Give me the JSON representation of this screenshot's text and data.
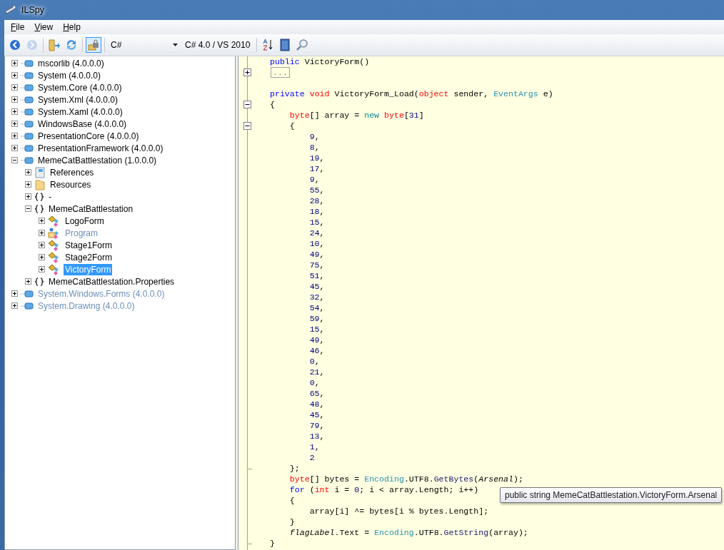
{
  "window": {
    "title": "ILSpy"
  },
  "menu": [
    {
      "label": "File"
    },
    {
      "label": "View"
    },
    {
      "label": "Help"
    }
  ],
  "toolbar": {
    "buttons": [
      {
        "kind": "back",
        "disabled": false,
        "selected": false
      },
      {
        "kind": "forward",
        "disabled": true,
        "selected": false
      },
      {
        "kind": "sep"
      },
      {
        "kind": "open",
        "disabled": false,
        "selected": false
      },
      {
        "kind": "refresh",
        "disabled": false,
        "selected": false
      },
      {
        "kind": "sep"
      },
      {
        "kind": "lock",
        "disabled": false,
        "selected": true
      },
      {
        "kind": "sep"
      }
    ],
    "language": "C#",
    "version": "C# 4.0 / VS 2010",
    "tools": [
      {
        "kind": "sort"
      },
      {
        "kind": "book"
      },
      {
        "kind": "search"
      }
    ]
  },
  "tree": [
    {
      "label": "mscorlib (4.0.0.0)",
      "kind": "assembly",
      "expanded": false,
      "selected": false,
      "dimmed": false
    },
    {
      "label": "System (4.0.0.0)",
      "kind": "assembly",
      "expanded": false,
      "selected": false,
      "dimmed": false
    },
    {
      "label": "System.Core (4.0.0.0)",
      "kind": "assembly",
      "expanded": false,
      "selected": false,
      "dimmed": false
    },
    {
      "label": "System.Xml (4.0.0.0)",
      "kind": "assembly",
      "expanded": false,
      "selected": false,
      "dimmed": false
    },
    {
      "label": "System.Xaml (4.0.0.0)",
      "kind": "assembly",
      "expanded": false,
      "selected": false,
      "dimmed": false
    },
    {
      "label": "WindowsBase (4.0.0.0)",
      "kind": "assembly",
      "expanded": false,
      "selected": false,
      "dimmed": false
    },
    {
      "label": "PresentationCore (4.0.0.0)",
      "kind": "assembly",
      "expanded": false,
      "selected": false,
      "dimmed": false
    },
    {
      "label": "PresentationFramework (4.0.0.0)",
      "kind": "assembly",
      "expanded": false,
      "selected": false,
      "dimmed": false
    },
    {
      "label": "MemeCatBattlestation (1.0.0.0)",
      "kind": "assembly",
      "expanded": true,
      "selected": false,
      "dimmed": false,
      "children": [
        {
          "label": "References",
          "kind": "references",
          "expanded": false,
          "selected": false,
          "dimmed": false
        },
        {
          "label": "Resources",
          "kind": "folder",
          "expanded": false,
          "selected": false,
          "dimmed": false
        },
        {
          "label": "-",
          "kind": "namespace",
          "expanded": false,
          "selected": false,
          "dimmed": false
        },
        {
          "label": "MemeCatBattlestation",
          "kind": "namespace",
          "expanded": true,
          "selected": false,
          "dimmed": false,
          "children": [
            {
              "label": "LogoForm",
              "kind": "class",
              "expanded": false,
              "selected": false,
              "dimmed": false
            },
            {
              "label": "Program",
              "kind": "static",
              "expanded": false,
              "selected": false,
              "dimmed": true
            },
            {
              "label": "Stage1Form",
              "kind": "class",
              "expanded": false,
              "selected": false,
              "dimmed": false
            },
            {
              "label": "Stage2Form",
              "kind": "class",
              "expanded": false,
              "selected": false,
              "dimmed": false
            },
            {
              "label": "VictoryForm",
              "kind": "class",
              "expanded": false,
              "selected": true,
              "dimmed": false
            }
          ]
        },
        {
          "label": "MemeCatBattlestation.Properties",
          "kind": "namespace",
          "expanded": false,
          "selected": false,
          "dimmed": false
        }
      ]
    },
    {
      "label": "System.Windows.Forms (4.0.0.0)",
      "kind": "assembly",
      "expanded": false,
      "selected": false,
      "dimmed": true
    },
    {
      "label": "System.Drawing (4.0.0.0)",
      "kind": "assembly",
      "expanded": false,
      "selected": false,
      "dimmed": true
    }
  ],
  "code": [
    {
      "tokens": [
        {
          "kind": "keyword",
          "text": "public"
        },
        {
          "kind": "plain",
          "text": " VictoryForm()"
        }
      ]
    },
    {
      "kind": "plus",
      "tokens": [
        {
          "kind": "collapsed",
          "text": "..."
        }
      ]
    },
    {
      "kind": "blank"
    },
    {
      "tokens": [
        {
          "kind": "keyword",
          "text": "private "
        },
        {
          "kind": "type",
          "text": "void"
        },
        {
          "kind": "plain",
          "text": " VictoryForm_Load("
        },
        {
          "kind": "type",
          "text": "object"
        },
        {
          "kind": "plain",
          "text": " sender, "
        },
        {
          "kind": "class",
          "text": "EventArgs"
        },
        {
          "kind": "plain",
          "text": " e)"
        }
      ]
    },
    {
      "kind": "minus",
      "tokens": [
        {
          "kind": "plain",
          "text": "{"
        }
      ]
    },
    {
      "tokens": [
        {
          "kind": "type",
          "text": "    byte"
        },
        {
          "kind": "plain",
          "text": "[] array = "
        },
        {
          "kind": "operator",
          "text": "new "
        },
        {
          "kind": "type",
          "text": "byte"
        },
        {
          "kind": "plain",
          "text": "["
        },
        {
          "kind": "number",
          "text": "31"
        },
        {
          "kind": "plain",
          "text": "]"
        }
      ]
    },
    {
      "kind": "minus",
      "tokens": [
        {
          "kind": "plain",
          "text": "    {"
        }
      ]
    },
    {
      "tokens": [
        {
          "kind": "number",
          "text": "        9"
        },
        {
          "kind": "plain",
          "text": ","
        }
      ]
    },
    {
      "tokens": [
        {
          "kind": "number",
          "text": "        8"
        },
        {
          "kind": "plain",
          "text": ","
        }
      ]
    },
    {
      "tokens": [
        {
          "kind": "number",
          "text": "        19"
        },
        {
          "kind": "plain",
          "text": ","
        }
      ]
    },
    {
      "tokens": [
        {
          "kind": "number",
          "text": "        17"
        },
        {
          "kind": "plain",
          "text": ","
        }
      ]
    },
    {
      "tokens": [
        {
          "kind": "number",
          "text": "        9"
        },
        {
          "kind": "plain",
          "text": ","
        }
      ]
    },
    {
      "tokens": [
        {
          "kind": "number",
          "text": "        55"
        },
        {
          "kind": "plain",
          "text": ","
        }
      ]
    },
    {
      "tokens": [
        {
          "kind": "number",
          "text": "        28"
        },
        {
          "kind": "plain",
          "text": ","
        }
      ]
    },
    {
      "tokens": [
        {
          "kind": "number",
          "text": "        18"
        },
        {
          "kind": "plain",
          "text": ","
        }
      ]
    },
    {
      "tokens": [
        {
          "kind": "number",
          "text": "        15"
        },
        {
          "kind": "plain",
          "text": ","
        }
      ]
    },
    {
      "tokens": [
        {
          "kind": "number",
          "text": "        24"
        },
        {
          "kind": "plain",
          "text": ","
        }
      ]
    },
    {
      "tokens": [
        {
          "kind": "number",
          "text": "        10"
        },
        {
          "kind": "plain",
          "text": ","
        }
      ]
    },
    {
      "tokens": [
        {
          "kind": "number",
          "text": "        49"
        },
        {
          "kind": "plain",
          "text": ","
        }
      ]
    },
    {
      "tokens": [
        {
          "kind": "number",
          "text": "        75"
        },
        {
          "kind": "plain",
          "text": ","
        }
      ]
    },
    {
      "tokens": [
        {
          "kind": "number",
          "text": "        51"
        },
        {
          "kind": "plain",
          "text": ","
        }
      ]
    },
    {
      "tokens": [
        {
          "kind": "number",
          "text": "        45"
        },
        {
          "kind": "plain",
          "text": ","
        }
      ]
    },
    {
      "tokens": [
        {
          "kind": "number",
          "text": "        32"
        },
        {
          "kind": "plain",
          "text": ","
        }
      ]
    },
    {
      "tokens": [
        {
          "kind": "number",
          "text": "        54"
        },
        {
          "kind": "plain",
          "text": ","
        }
      ]
    },
    {
      "tokens": [
        {
          "kind": "number",
          "text": "        59"
        },
        {
          "kind": "plain",
          "text": ","
        }
      ]
    },
    {
      "tokens": [
        {
          "kind": "number",
          "text": "        15"
        },
        {
          "kind": "plain",
          "text": ","
        }
      ]
    },
    {
      "tokens": [
        {
          "kind": "number",
          "text": "        49"
        },
        {
          "kind": "plain",
          "text": ","
        }
      ]
    },
    {
      "tokens": [
        {
          "kind": "number",
          "text": "        46"
        },
        {
          "kind": "plain",
          "text": ","
        }
      ]
    },
    {
      "tokens": [
        {
          "kind": "number",
          "text": "        0"
        },
        {
          "kind": "plain",
          "text": ","
        }
      ]
    },
    {
      "tokens": [
        {
          "kind": "number",
          "text": "        21"
        },
        {
          "kind": "plain",
          "text": ","
        }
      ]
    },
    {
      "tokens": [
        {
          "kind": "number",
          "text": "        0"
        },
        {
          "kind": "plain",
          "text": ","
        }
      ]
    },
    {
      "tokens": [
        {
          "kind": "number",
          "text": "        65"
        },
        {
          "kind": "plain",
          "text": ","
        }
      ]
    },
    {
      "tokens": [
        {
          "kind": "number",
          "text": "        48"
        },
        {
          "kind": "plain",
          "text": ","
        }
      ]
    },
    {
      "tokens": [
        {
          "kind": "number",
          "text": "        45"
        },
        {
          "kind": "plain",
          "text": ","
        }
      ]
    },
    {
      "tokens": [
        {
          "kind": "number",
          "text": "        79"
        },
        {
          "kind": "plain",
          "text": ","
        }
      ]
    },
    {
      "tokens": [
        {
          "kind": "number",
          "text": "        13"
        },
        {
          "kind": "plain",
          "text": ","
        }
      ]
    },
    {
      "tokens": [
        {
          "kind": "number",
          "text": "        1"
        },
        {
          "kind": "plain",
          "text": ","
        }
      ]
    },
    {
      "tokens": [
        {
          "kind": "number",
          "text": "        2"
        }
      ]
    },
    {
      "kind": "end",
      "tokens": [
        {
          "kind": "plain",
          "text": "    };"
        }
      ]
    },
    {
      "tokens": [
        {
          "kind": "type",
          "text": "    byte"
        },
        {
          "kind": "plain",
          "text": "[] bytes = "
        },
        {
          "kind": "class",
          "text": "Encoding"
        },
        {
          "kind": "plain",
          "text": ".UTF8."
        },
        {
          "kind": "method",
          "text": "GetBytes"
        },
        {
          "kind": "plain",
          "text": "("
        },
        {
          "kind": "field",
          "text": "Arsenal"
        },
        {
          "kind": "plain",
          "text": ");"
        }
      ]
    },
    {
      "tokens": [
        {
          "kind": "keyword",
          "text": "    for"
        },
        {
          "kind": "plain",
          "text": " ("
        },
        {
          "kind": "type",
          "text": "int"
        },
        {
          "kind": "plain",
          "text": " i = "
        },
        {
          "kind": "number",
          "text": "0"
        },
        {
          "kind": "plain",
          "text": "; i < array.Length; i++)"
        }
      ]
    },
    {
      "tokens": [
        {
          "kind": "plain",
          "text": "    {"
        }
      ]
    },
    {
      "tokens": [
        {
          "kind": "plain",
          "text": "        array[i] ^= bytes[i % bytes.Length];"
        }
      ]
    },
    {
      "tokens": [
        {
          "kind": "plain",
          "text": "    }"
        }
      ]
    },
    {
      "tokens": [
        {
          "kind": "field",
          "text": "    flagLabel"
        },
        {
          "kind": "plain",
          "text": ".Text = "
        },
        {
          "kind": "class",
          "text": "Encoding"
        },
        {
          "kind": "plain",
          "text": ".UTF8."
        },
        {
          "kind": "method",
          "text": "GetString"
        },
        {
          "kind": "plain",
          "text": "(array);"
        }
      ]
    },
    {
      "kind": "end",
      "tokens": [
        {
          "kind": "plain",
          "text": "}"
        }
      ]
    }
  ],
  "tooltip": "public string MemeCatBattlestation.VictoryForm.Arsenal"
}
